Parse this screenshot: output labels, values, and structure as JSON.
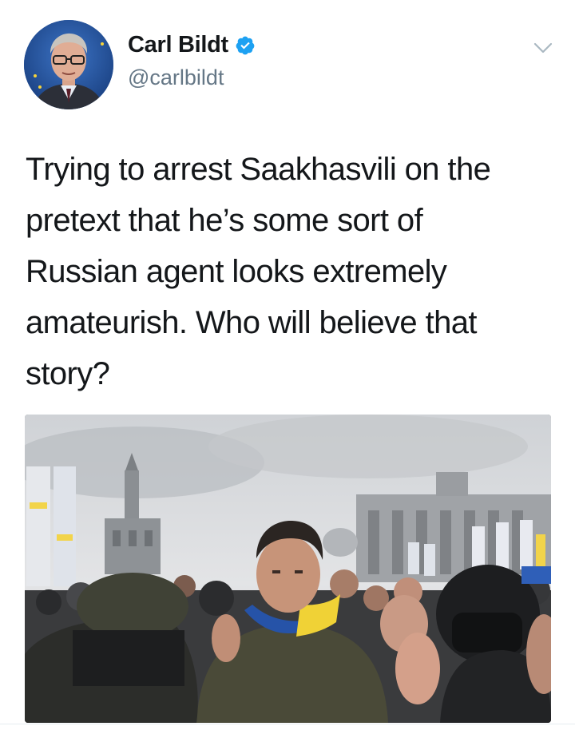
{
  "tweet": {
    "author": {
      "display_name": "Carl Bildt",
      "handle": "@carlbildt",
      "verified": true,
      "avatar_icon": "profile-photo"
    },
    "menu_icon": "chevron-down-icon",
    "text": "Trying to arrest Saakhasvili on the\npretext that he’s some sort of\nRussian agent looks extremely\namateurish. Who will believe that\nstory?",
    "media": {
      "type": "photo",
      "description_icon": "crowd-photo"
    }
  },
  "colors": {
    "verified_blue": "#1da1f2",
    "handle_gray": "#657786",
    "text": "#14171a"
  }
}
